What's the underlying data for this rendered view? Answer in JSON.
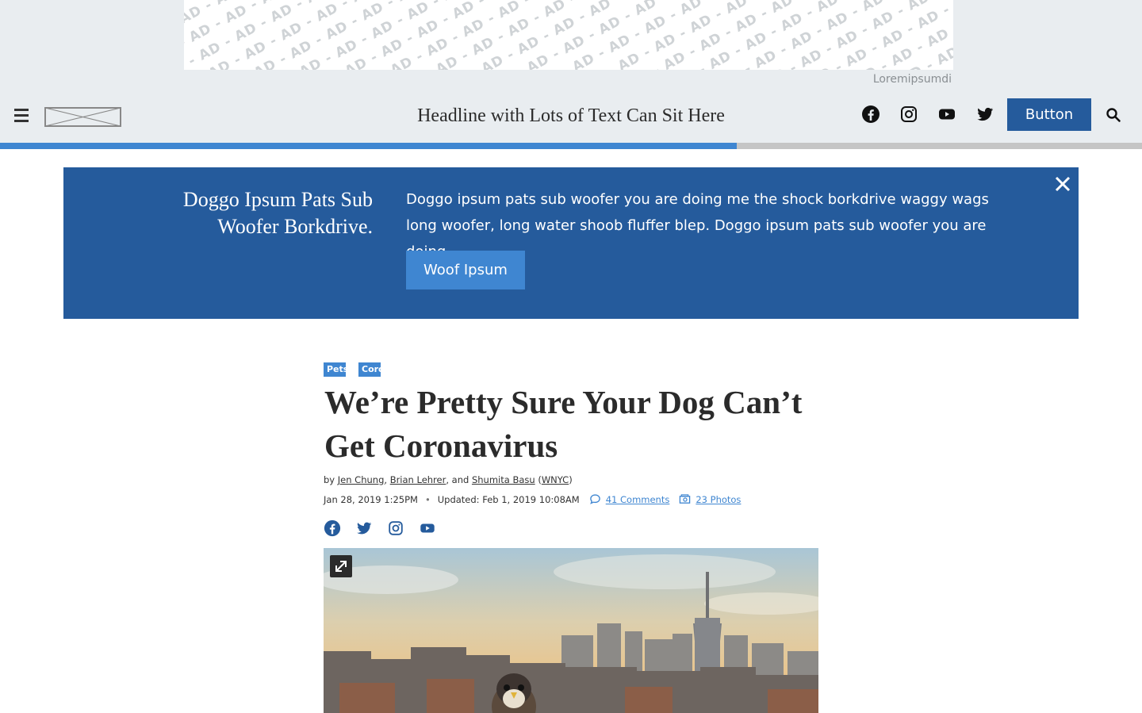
{
  "ad": {
    "pattern_text": "- AD - AD - AD - AD - AD - AD - AD - AD - AD - AD - AD - AD - AD - AD - AD - AD - AD - AD - AD - AD - AD - AD -",
    "label": "Loremipsumdi"
  },
  "header": {
    "title": "Headline with Lots of Text Can Sit Here",
    "button_label": "Button",
    "social_icons": [
      "facebook-icon",
      "instagram-icon",
      "youtube-icon",
      "twitter-icon"
    ]
  },
  "reading_progress": 0.645,
  "promo": {
    "title": "Doggo Ipsum Pats Sub Woofer Borkdrive.",
    "text": "Doggo ipsum pats sub woofer you are doing me the shock borkdrive waggy wags long woofer, long water shoob fluffer blep. Doggo ipsum pats sub woofer you are doing.",
    "button_label": "Woof Ipsum"
  },
  "article": {
    "tags": [
      "Pets",
      "Coronavirus"
    ],
    "title": "We’re Pretty Sure Your Dog Can’t Get Coronavirus",
    "byline": {
      "prefix": "by",
      "author1": "Jen Chung",
      "sep1": ",",
      "author2": "Brian Lehrer",
      "sep2": ", and",
      "author3": "Shumita Basu",
      "org_open": "(",
      "org": "WNYC",
      "org_close": ")"
    },
    "published": "Jan 28, 2019 1:25PM",
    "dot": "•",
    "updated": "Updated: Feb 1, 2019 10:08AM",
    "comments": "41 Comments",
    "photos": "23 Photos",
    "social_icons": [
      "facebook-icon",
      "twitter-icon",
      "instagram-icon",
      "youtube-icon"
    ]
  },
  "colors": {
    "brand_blue": "#255b9c",
    "accent_blue": "#3f86d1",
    "band_gray": "#e9edf0"
  }
}
